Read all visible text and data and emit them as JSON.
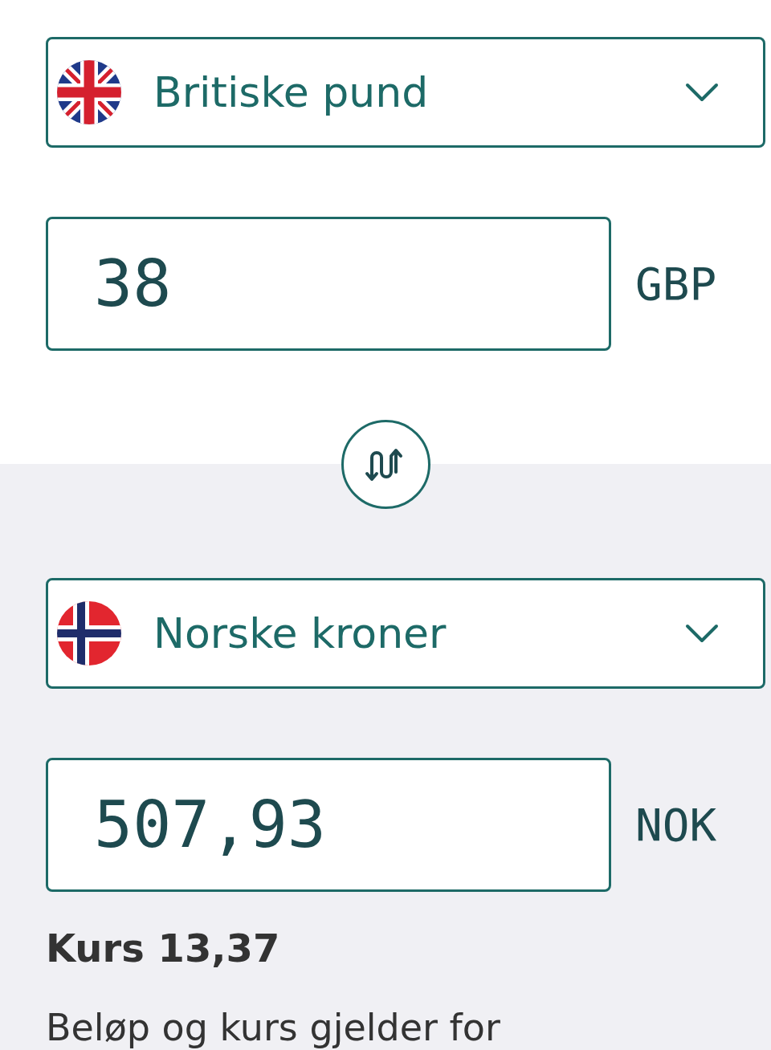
{
  "from": {
    "currency": {
      "kind": "british",
      "name": "Britiske pund"
    },
    "amount": {
      "value": "38"
    },
    "code": "GBP"
  },
  "to": {
    "currency": {
      "kind": "norwegian",
      "name": "Norske kroner"
    },
    "amount": {
      "value": "507,93"
    },
    "code": "NOK"
  },
  "rate": "Kurs 13,37",
  "note": "Beløp og kurs gjelder for"
}
